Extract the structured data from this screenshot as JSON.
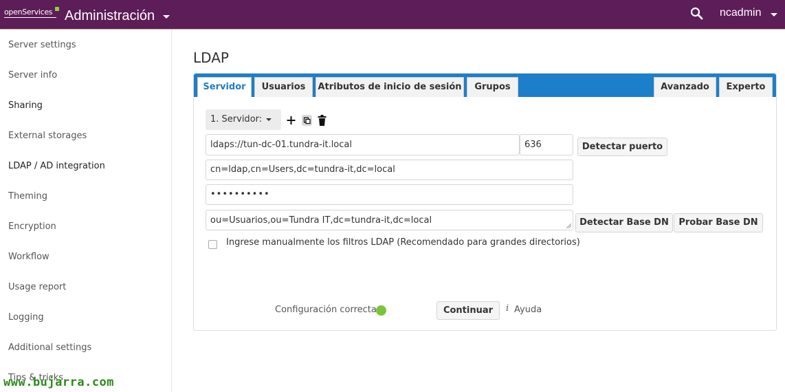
{
  "header": {
    "logo_text": "openServices",
    "app_title": "Administración",
    "user_name": "ncadmin",
    "search_icon": "search-icon",
    "accent_color": "#5d1d58"
  },
  "sidebar": {
    "items": [
      {
        "label": "Server settings"
      },
      {
        "label": "Server info"
      },
      {
        "label": "Sharing"
      },
      {
        "label": "External storages"
      },
      {
        "label": "LDAP / AD integration"
      },
      {
        "label": "Theming"
      },
      {
        "label": "Encryption"
      },
      {
        "label": "Workflow"
      },
      {
        "label": "Usage report"
      },
      {
        "label": "Logging"
      },
      {
        "label": "Additional settings"
      },
      {
        "label": "Tips & tricks"
      }
    ],
    "watermark": "www.bujarra.com"
  },
  "main": {
    "title": "LDAP",
    "tabs": [
      {
        "label": "Servidor",
        "active": true
      },
      {
        "label": "Usuarios"
      },
      {
        "label": "Atributos de inicio de sesión"
      },
      {
        "label": "Grupos"
      },
      {
        "label": "Avanzado"
      },
      {
        "label": "Experto"
      }
    ],
    "tab_bar_color": "#1d7ec9",
    "server": {
      "select_label": "1. Servidor:",
      "host_value": "ldaps://tun-dc-01.tundra-it.local",
      "port_value": "636",
      "detect_port_label": "Detectar puerto",
      "user_dn_value": "cn=ldap,cn=Users,dc=tundra-it,dc=local",
      "password_value": "••••••••••",
      "base_dn_value": "ou=Usuarios,ou=Tundra IT,dc=tundra-it,dc=local",
      "detect_base_dn_label": "Detectar Base DN",
      "test_base_dn_label": "Probar Base DN",
      "manual_filter_label": "Ingrese manualmente los filtros LDAP (Recomendado para grandes directorios)",
      "manual_filter_checked": false
    },
    "footer": {
      "status_text": "Configuración correcta",
      "status_color": "#7ac43a",
      "continue_label": "Continuar",
      "help_icon": "i",
      "help_label": "Ayuda"
    }
  }
}
